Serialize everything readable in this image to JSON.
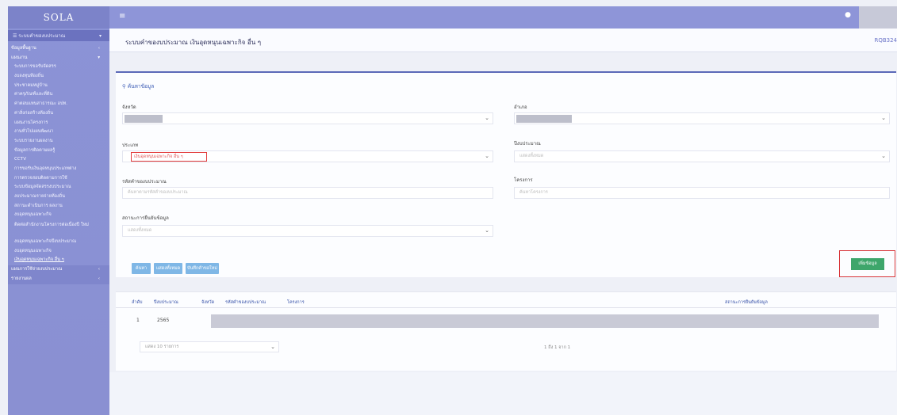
{
  "app": {
    "brand": "SOLA"
  },
  "sidebar": {
    "top_menu": "ระบบคำของบประมาณ",
    "items": [
      {
        "label": "ข้อมูลพื้นฐาน",
        "type": "section"
      },
      {
        "label": "แผนงาน",
        "type": "section"
      },
      {
        "label": "ระบบการขอรับจัดสรร",
        "type": "item"
      },
      {
        "label": "งบลงทุนท้องถิ่น",
        "type": "item"
      },
      {
        "label": "ประชาคมหมู่บ้าน",
        "type": "item"
      },
      {
        "label": "ค่าครุภัณฑ์และที่ดิน",
        "type": "item"
      },
      {
        "label": "ค่าตอบแทนสาธารณะ อปท.",
        "type": "item"
      },
      {
        "label": "ค่าสิ่งก่อสร้างท้องถิ่น",
        "type": "item"
      },
      {
        "label": "แผนงานโครงการ",
        "type": "item"
      },
      {
        "label": "งานทั่วไปแผนพัฒนา",
        "type": "item"
      },
      {
        "label": "ระบบรายงานผลงาน",
        "type": "item"
      },
      {
        "label": "ข้อมูลการติดตามผลรู้",
        "type": "item"
      },
      {
        "label": "CCTV",
        "type": "item"
      },
      {
        "label": "การขอรับเงินอุดหนุนประเภทต่าง",
        "type": "item"
      },
      {
        "label": "การตรวจสอบติดตามการใช้",
        "type": "item"
      },
      {
        "label": "ระบบข้อมูลจัดสรรงบประมาณ",
        "type": "item"
      },
      {
        "label": "งบประมาณรายจ่ายท้องถิ่น",
        "type": "item"
      },
      {
        "label": "สถานะดำเนินการ ผลงาน",
        "type": "item"
      },
      {
        "label": "งบอุดหนุนเฉพาะกิจ",
        "type": "item"
      },
      {
        "label": "ติดต่อสำนักงานโครงการต่อเนื่องปี ใหม่",
        "type": "wrap"
      },
      {
        "label": "งบอุดหนุนเฉพาะกิจปีงบประมาณ",
        "type": "item"
      },
      {
        "label": "งบอุดหนุนเฉพาะกิจ",
        "type": "item"
      },
      {
        "label": "เงินอุดหนุนเฉพาะกิจ อื่น ๆ",
        "type": "active"
      },
      {
        "label": "แผนการใช้จ่ายงบประมาณ",
        "type": "bottom-section"
      },
      {
        "label": "รายงานผล",
        "type": "bottom-section"
      }
    ]
  },
  "page": {
    "title": "ระบบคำของบประมาณ เงินอุดหนุนเฉพาะกิจ อื่น ๆ",
    "code": "RQB324"
  },
  "search": {
    "heading": "ค้นหาข้อมูล",
    "labels": {
      "province": "จังหวัด",
      "district": "อำเภอ",
      "category": "ประเภท",
      "fiscal_year": "ปีงบประมาณ",
      "request_code": "รหัสคำของบประมาณ",
      "project": "โครงการ",
      "status": "สถานะการยืนยันข้อมูล"
    },
    "values": {
      "category": "เงินอุดหนุนเฉพาะกิจ อื่น ๆ",
      "fiscal_year": "แสดงทั้งหมด",
      "request_code": "ค้นหาตามรหัสคำของบประมาณ",
      "project": "ค้นหาโครงการ",
      "status": "แสดงทั้งหมด"
    },
    "buttons": {
      "search": "ค้นหา",
      "show_all": "แสดงทั้งหมด",
      "new_request": "บันทึกคำขอใหม่",
      "add_data": "เพิ่มข้อมูล"
    }
  },
  "table": {
    "headers": [
      "ลำดับ",
      "ปีงบประมาณ",
      "จังหวัด",
      "รหัสคำของบประมาณ",
      "โครงการ",
      "สถานะการยืนยันข้อมูล"
    ],
    "rows": [
      {
        "index": "1",
        "year": "2565"
      }
    ],
    "page_size": "แสดง 10 รายการ",
    "pager_info": "1 ถึง 1 จาก 1"
  }
}
